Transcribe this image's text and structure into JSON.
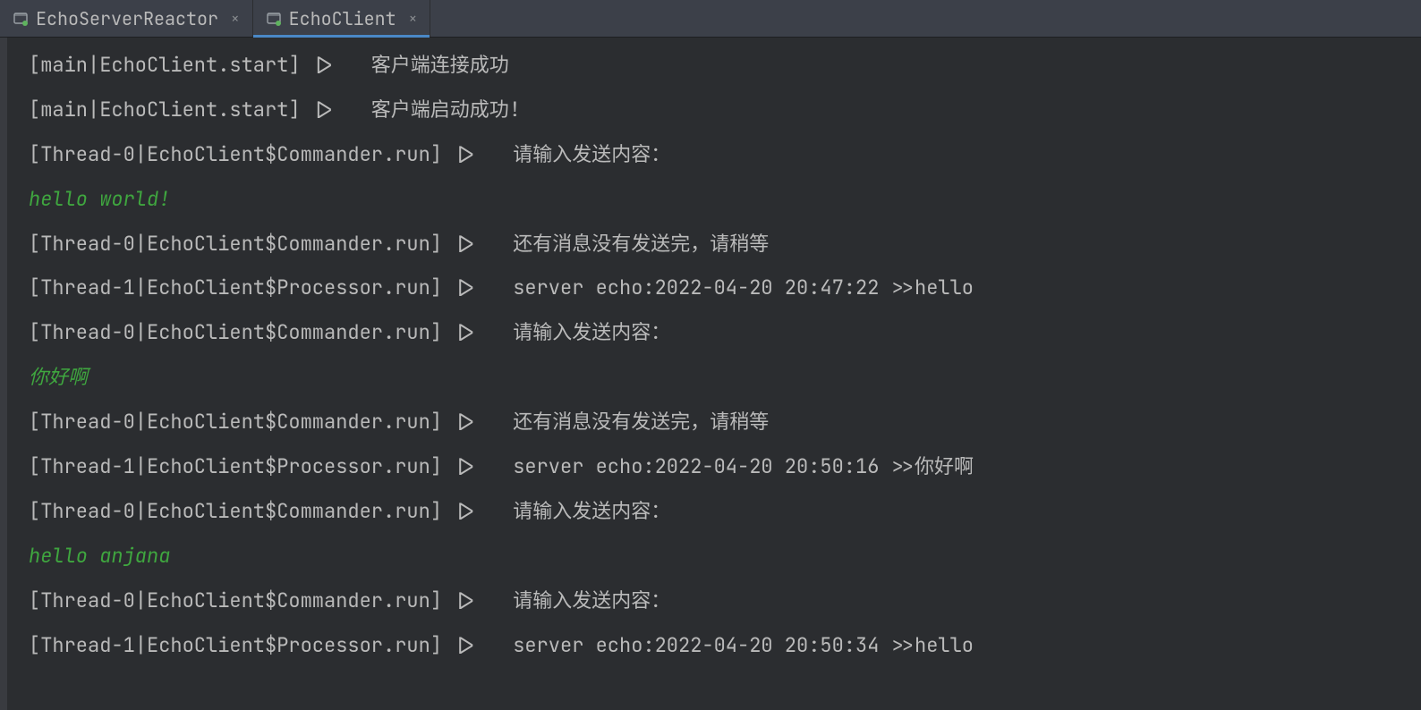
{
  "tabs": [
    {
      "label": "EchoServerReactor",
      "active": false
    },
    {
      "label": "EchoClient",
      "active": true
    }
  ],
  "console": {
    "lines": [
      {
        "type": "log",
        "text": "[main|EchoClient.start] |>   客户端连接成功"
      },
      {
        "type": "log",
        "text": "[main|EchoClient.start] |>   客户端启动成功!"
      },
      {
        "type": "log",
        "text": "[Thread-0|EchoClient$Commander.run] |>   请输入发送内容："
      },
      {
        "type": "input",
        "text": "hello world!"
      },
      {
        "type": "log",
        "text": "[Thread-0|EchoClient$Commander.run] |>   还有消息没有发送完，请稍等"
      },
      {
        "type": "log",
        "text": "[Thread-1|EchoClient$Processor.run] |>   server echo:2022-04-20 20:47:22 >>hello"
      },
      {
        "type": "log",
        "text": "[Thread-0|EchoClient$Commander.run] |>   请输入发送内容："
      },
      {
        "type": "input",
        "text": "你好啊"
      },
      {
        "type": "log",
        "text": "[Thread-0|EchoClient$Commander.run] |>   还有消息没有发送完，请稍等"
      },
      {
        "type": "log",
        "text": "[Thread-1|EchoClient$Processor.run] |>   server echo:2022-04-20 20:50:16 >>你好啊"
      },
      {
        "type": "log",
        "text": "[Thread-0|EchoClient$Commander.run] |>   请输入发送内容："
      },
      {
        "type": "input",
        "text": "hello anjana"
      },
      {
        "type": "log",
        "text": "[Thread-0|EchoClient$Commander.run] |>   请输入发送内容："
      },
      {
        "type": "log",
        "text": "[Thread-1|EchoClient$Processor.run] |>   server echo:2022-04-20 20:50:34 >>hello"
      }
    ]
  }
}
